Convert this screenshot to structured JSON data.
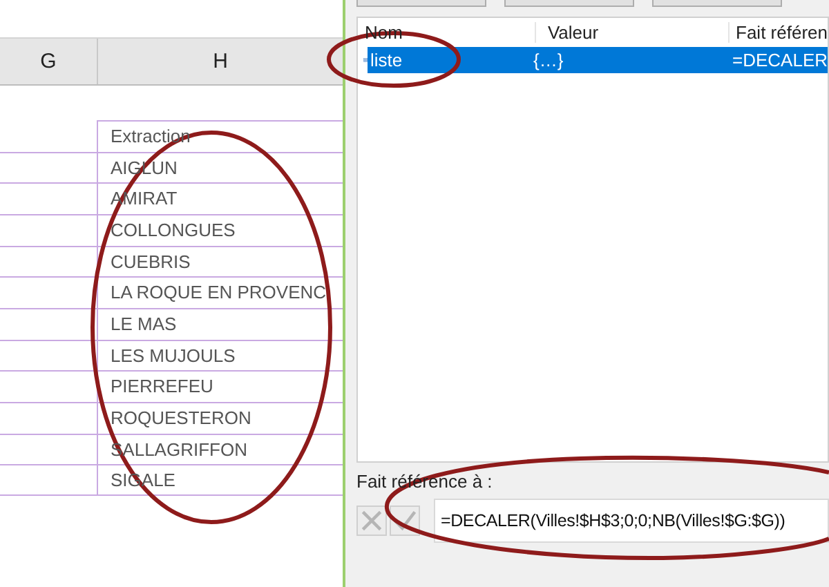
{
  "spreadsheet": {
    "column_headers": [
      "G",
      "H"
    ],
    "cells_h": [
      "Extraction",
      "AIGLUN",
      "AMIRAT",
      "COLLONGUES",
      "CUEBRIS",
      "LA ROQUE EN PROVENC",
      "LE MAS",
      "LES MUJOULS",
      "PIERREFEU",
      "ROQUESTERON",
      "SALLAGRIFFON",
      "SIGALE"
    ]
  },
  "name_list": {
    "columns": [
      "Nom",
      "Valeur",
      "Fait référen"
    ],
    "rows": [
      {
        "name": "liste",
        "value": "{…}",
        "refers_to": "=DECALER",
        "selected": true
      }
    ]
  },
  "refers_to": {
    "label": "Fait référence à :",
    "value": "=DECALER(Villes!$H$3;0;0;NB(Villes!$G:$G))",
    "buttons": [
      {
        "kind": "cancel",
        "disabled": true
      },
      {
        "kind": "enter",
        "disabled": true
      }
    ]
  }
}
